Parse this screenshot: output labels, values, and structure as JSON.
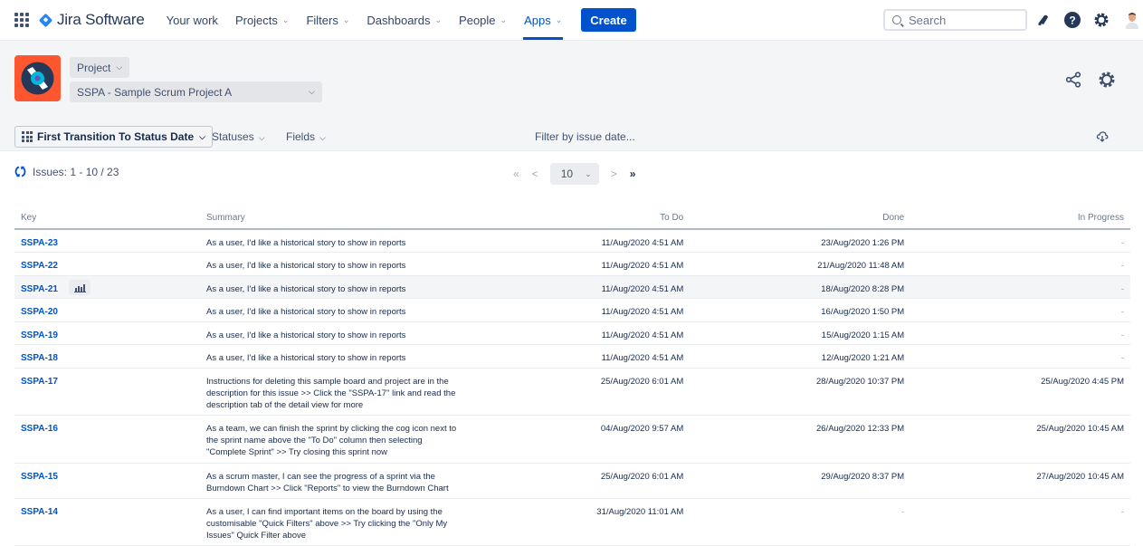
{
  "topnav": {
    "app_name": "Jira Software",
    "items": [
      {
        "label": "Your work",
        "has_dropdown": false
      },
      {
        "label": "Projects",
        "has_dropdown": true
      },
      {
        "label": "Filters",
        "has_dropdown": true
      },
      {
        "label": "Dashboards",
        "has_dropdown": true
      },
      {
        "label": "People",
        "has_dropdown": true
      },
      {
        "label": "Apps",
        "has_dropdown": true,
        "active": true
      }
    ],
    "create_label": "Create",
    "search_placeholder": "Search",
    "icons": [
      "notifications-icon",
      "help-icon",
      "settings-icon",
      "user-avatar"
    ]
  },
  "project": {
    "type_label": "Project",
    "selected": "SSPA - Sample Scrum Project A",
    "avatar_color": "#ff5630"
  },
  "toolbar": {
    "field_select": "First Transition To Status Date",
    "statuses_label": "Statuses",
    "fields_label": "Fields",
    "filter_date_label": "Filter by issue date..."
  },
  "issues": {
    "count_text": "Issues: 1 - 10 / 23",
    "page_size": "10",
    "pager": {
      "first": "«",
      "prev": "<",
      "next": ">",
      "last": "»"
    }
  },
  "table": {
    "headers": {
      "key": "Key",
      "summary": "Summary",
      "todo": "To Do",
      "done": "Done",
      "in_progress": "In Progress"
    },
    "rows": [
      {
        "key": "SSPA-23",
        "summary": "As a user, I'd like a historical story to show in reports",
        "todo": "11/Aug/2020 4:51 AM",
        "done": "23/Aug/2020 1:26 PM",
        "in_progress": "-"
      },
      {
        "key": "SSPA-22",
        "summary": "As a user, I'd like a historical story to show in reports",
        "todo": "11/Aug/2020 4:51 AM",
        "done": "21/Aug/2020 11:48 AM",
        "in_progress": "-"
      },
      {
        "key": "SSPA-21",
        "summary": "As a user, I'd like a historical story to show in reports",
        "todo": "11/Aug/2020 4:51 AM",
        "done": "18/Aug/2020 8:28 PM",
        "in_progress": "-",
        "hovered": true
      },
      {
        "key": "SSPA-20",
        "summary": "As a user, I'd like a historical story to show in reports",
        "todo": "11/Aug/2020 4:51 AM",
        "done": "16/Aug/2020 1:50 PM",
        "in_progress": "-"
      },
      {
        "key": "SSPA-19",
        "summary": "As a user, I'd like a historical story to show in reports",
        "todo": "11/Aug/2020 4:51 AM",
        "done": "15/Aug/2020 1:15 AM",
        "in_progress": "-"
      },
      {
        "key": "SSPA-18",
        "summary": "As a user, I'd like a historical story to show in reports",
        "todo": "11/Aug/2020 4:51 AM",
        "done": "12/Aug/2020 1:21 AM",
        "in_progress": "-"
      },
      {
        "key": "SSPA-17",
        "summary": "Instructions for deleting this sample board and project are in the description for this issue >> Click the \"SSPA-17\" link and read the description tab of the detail view for more",
        "todo": "25/Aug/2020 6:01 AM",
        "done": "28/Aug/2020 10:37 PM",
        "in_progress": "25/Aug/2020 4:45 PM"
      },
      {
        "key": "SSPA-16",
        "summary": "As a team, we can finish the sprint by clicking the cog icon next to the sprint name above the \"To Do\" column then selecting \"Complete Sprint\" >> Try closing this sprint now",
        "todo": "04/Aug/2020 9:57 AM",
        "done": "26/Aug/2020 12:33 PM",
        "in_progress": "25/Aug/2020 10:45 AM"
      },
      {
        "key": "SSPA-15",
        "summary": "As a scrum master, I can see the progress of a sprint via the Burndown Chart >> Click \"Reports\" to view the Burndown Chart",
        "todo": "25/Aug/2020 6:01 AM",
        "done": "29/Aug/2020 8:37 PM",
        "in_progress": "27/Aug/2020 10:45 AM"
      },
      {
        "key": "SSPA-14",
        "summary": "As a user, I can find important items on the board by using the customisable \"Quick Filters\" above >> Try clicking the \"Only My Issues\" Quick Filter above",
        "todo": "31/Aug/2020 11:01 AM",
        "done": "-",
        "in_progress": "-"
      }
    ]
  }
}
